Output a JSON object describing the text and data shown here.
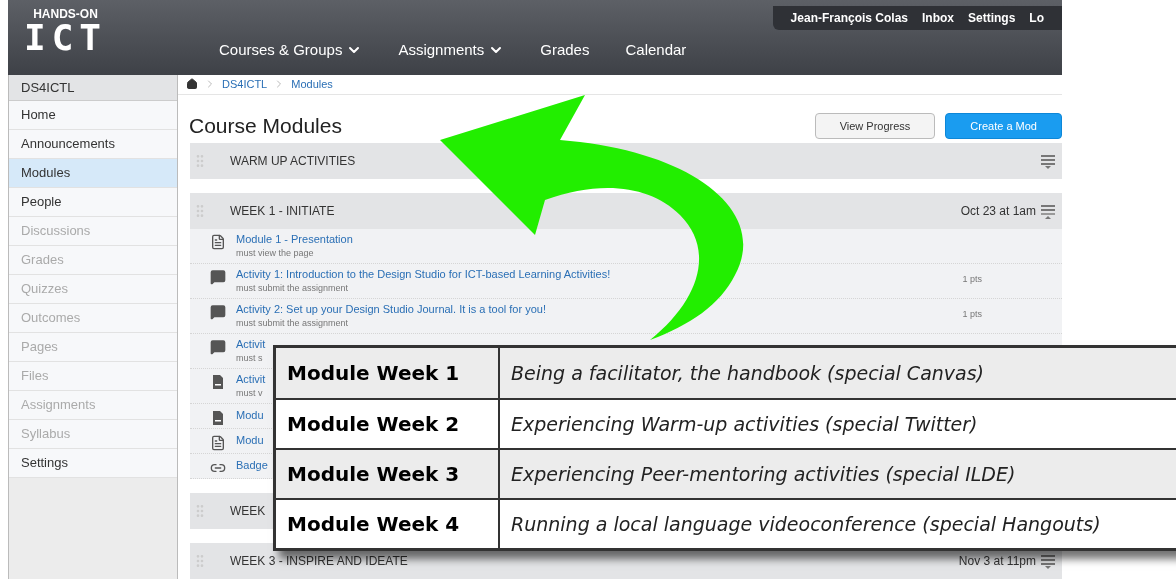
{
  "header": {
    "logo_top": "HANDS-ON",
    "logo_main": "ICT",
    "nav": [
      {
        "label": "Courses & Groups",
        "dropdown": true
      },
      {
        "label": "Assignments",
        "dropdown": true
      },
      {
        "label": "Grades",
        "dropdown": false
      },
      {
        "label": "Calendar",
        "dropdown": false
      }
    ],
    "user_links": [
      "Jean-François Colas",
      "Inbox",
      "Settings",
      "Lo"
    ]
  },
  "sidebar": {
    "title": "DS4ICTL",
    "items": [
      {
        "label": "Home",
        "selected": false,
        "disabled": false
      },
      {
        "label": "Announcements",
        "selected": false,
        "disabled": false
      },
      {
        "label": "Modules",
        "selected": true,
        "disabled": false
      },
      {
        "label": "People",
        "selected": false,
        "disabled": false
      },
      {
        "label": "Discussions",
        "selected": false,
        "disabled": true
      },
      {
        "label": "Grades",
        "selected": false,
        "disabled": true
      },
      {
        "label": "Quizzes",
        "selected": false,
        "disabled": true
      },
      {
        "label": "Outcomes",
        "selected": false,
        "disabled": true
      },
      {
        "label": "Pages",
        "selected": false,
        "disabled": true
      },
      {
        "label": "Files",
        "selected": false,
        "disabled": true
      },
      {
        "label": "Assignments",
        "selected": false,
        "disabled": true
      },
      {
        "label": "Syllabus",
        "selected": false,
        "disabled": true
      },
      {
        "label": "Settings",
        "selected": false,
        "disabled": false
      }
    ]
  },
  "breadcrumb": [
    "DS4ICTL",
    "Modules"
  ],
  "title": "Course Modules",
  "buttons": [
    {
      "label": "View Progress",
      "primary": false
    },
    {
      "label": "Create a Mod",
      "primary": true
    }
  ],
  "modules": [
    {
      "name": "WARM UP ACTIVITIES",
      "expanded": false
    },
    {
      "name": "WEEK 1 - INITIATE",
      "date": "Oct 23 at 1am",
      "expanded": true,
      "items": [
        {
          "kind": "page",
          "title": "Module 1 - Presentation",
          "requirement": "must view the page"
        },
        {
          "kind": "discussion",
          "title": "Activity 1: Introduction to the Design Studio for ICT-based Learning Activities!",
          "requirement": "must submit the assignment",
          "points": "1 pts"
        },
        {
          "kind": "discussion",
          "title": "Activity 2: Set up your Design Studio Journal. It is a tool for you!",
          "requirement": "must submit the assignment",
          "points": "1 pts"
        },
        {
          "kind": "discussion",
          "title": "Activit",
          "requirement": "must s"
        },
        {
          "kind": "assignment",
          "title": "Activit",
          "requirement": "must v"
        },
        {
          "kind": "assignment",
          "title": "Modu"
        },
        {
          "kind": "page",
          "title": "Modu"
        },
        {
          "kind": "link",
          "title": "Badge"
        }
      ]
    },
    {
      "name": "WEEK",
      "expanded": false
    },
    {
      "name": "WEEK 3 - INSPIRE AND IDEATE",
      "date": "Nov 3 at 11pm",
      "expanded": false
    }
  ],
  "overlay_table": [
    {
      "module": "Module Week 1",
      "topic": "Being a facilitator, the handbook (special Canvas)"
    },
    {
      "module": "Module Week 2",
      "topic": "Experiencing Warm-up activities (special Twitter)"
    },
    {
      "module": "Module Week 3",
      "topic": "Experiencing Peer-mentoring activities (special ILDE)"
    },
    {
      "module": "Module Week 4",
      "topic": "Running a local language videoconference (special Hangouts)"
    }
  ]
}
